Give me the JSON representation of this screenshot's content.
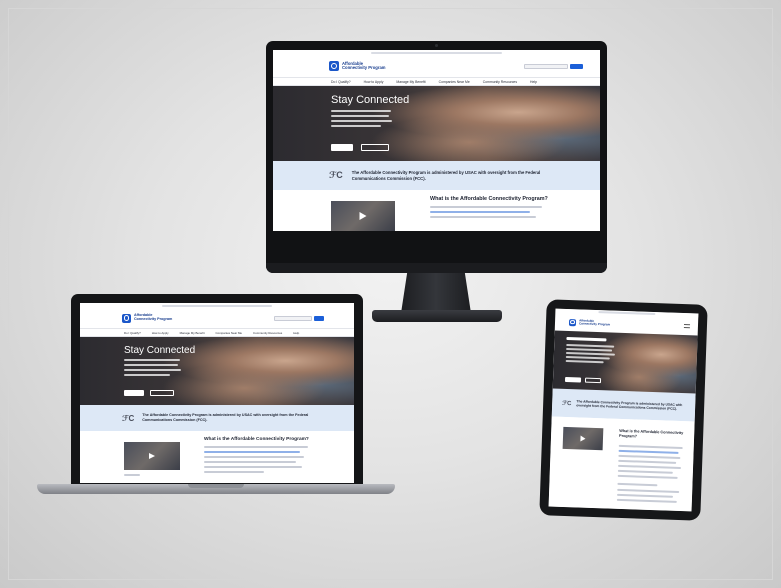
{
  "desktop": {
    "logo_line1": "Affordable",
    "logo_line2": "Connectivity Program",
    "nav": [
      "Do I Qualify?",
      "How to Apply",
      "Manage My Benefit",
      "Companies Near Me",
      "Community Resources",
      "Help"
    ],
    "hero_title": "Stay Connected",
    "banner_text": "The Affordable Connectivity Program is administered by USAC with oversight from the Federal Communications Commission (FCC).",
    "section_title": "What is the Affordable Connectivity Program?"
  },
  "laptop": {
    "logo_line1": "Affordable",
    "logo_line2": "Connectivity Program",
    "nav": [
      "Do I Qualify?",
      "How to Apply",
      "Manage My Benefit",
      "Companies Near Me",
      "Community Resources",
      "Help"
    ],
    "hero_title": "Stay Connected",
    "banner_text": "The Affordable Connectivity Program is administered by USAC with oversight from the Federal Communications Commission (FCC).",
    "section_title": "What is the Affordable Connectivity Program?"
  },
  "tablet": {
    "logo_line1": "Affordable",
    "logo_line2": "Connectivity Program",
    "banner_text": "The Affordable Connectivity Program is administered by USAC with oversight from the Federal Communications Commission (FCC).",
    "section_title": "What is the Affordable Connectivity Program?"
  },
  "colors": {
    "brand_blue": "#1b57c9",
    "banner_bg": "#dde8f6",
    "device_dark": "#111214"
  },
  "icons": [
    "fcc-logo-icon",
    "play-icon",
    "search-icon"
  ]
}
